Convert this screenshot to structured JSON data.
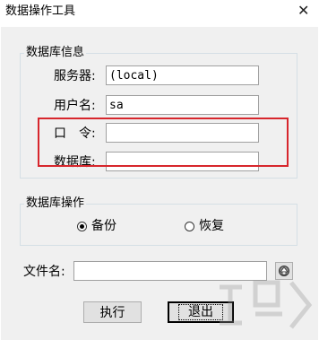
{
  "window": {
    "title": "数据操作工具",
    "close_glyph": "✕"
  },
  "db_info": {
    "legend": "数据库信息",
    "server_label": "服务器:",
    "server_value": "(local)",
    "user_label": "用户名:",
    "user_value": "sa",
    "password_label": "口　令:",
    "password_value": "",
    "database_label": "数据库:",
    "database_value": ""
  },
  "db_ops": {
    "legend": "数据库操作",
    "backup_label": "备份",
    "restore_label": "恢复",
    "selected": "备份"
  },
  "file": {
    "label": "文件名:",
    "value": "",
    "browse_icon": "folder-browse-icon"
  },
  "buttons": {
    "execute_label": "执行",
    "exit_label": "退出"
  },
  "colors": {
    "highlight_box": "#d7262c",
    "window_bg": "#f0f0f0"
  }
}
